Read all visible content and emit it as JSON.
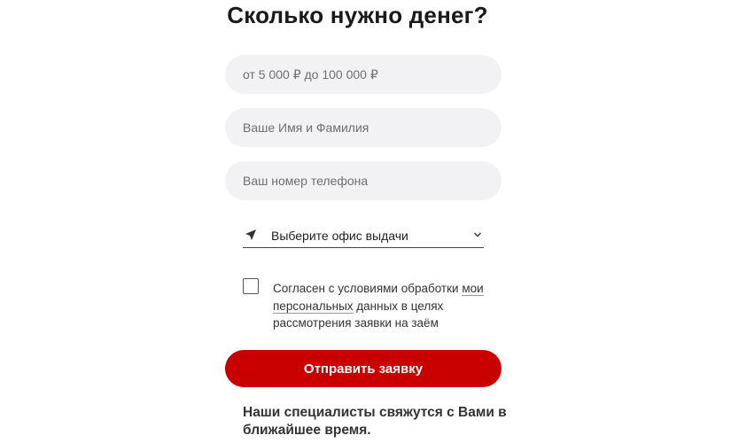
{
  "form": {
    "title": "Сколько нужно денег?",
    "amount": {
      "value": "",
      "placeholder": "от 5 000 ₽ до 100 000 ₽"
    },
    "name": {
      "value": "",
      "placeholder": "Ваше Имя и Фамилия"
    },
    "phone": {
      "value": "",
      "placeholder": "Ваш номер телефона"
    },
    "office": {
      "selected_label": "Выберите офис выдачи",
      "icon": "location-arrow-icon",
      "dropdown_icon": "chevron-down-icon"
    },
    "consent": {
      "checked": false,
      "text_before": "Согласен с условиями обработки ",
      "link_text": "мои персональных",
      "text_after": " данных в целях рассмотрения заявки на заём"
    },
    "submit_label": "Отправить заявку",
    "note": "Наши специалисты свяжутся с Вами в ближайшее время."
  },
  "colors": {
    "accent": "#c90000",
    "field_bg": "#f2f2f4",
    "text": "#222222"
  }
}
